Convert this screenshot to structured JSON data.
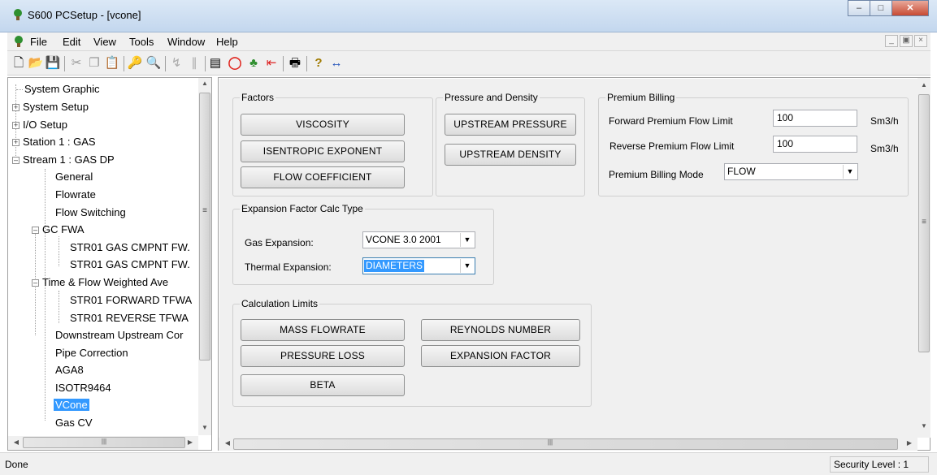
{
  "window": {
    "title": "S600 PCSetup - [vcone]"
  },
  "menu": {
    "file": "File",
    "edit": "Edit",
    "view": "View",
    "tools": "Tools",
    "window": "Window",
    "help": "Help"
  },
  "tree": {
    "items": [
      {
        "label": "System Graphic"
      },
      {
        "label": "System Setup"
      },
      {
        "label": "I/O Setup"
      },
      {
        "label": "Station 1 : GAS"
      },
      {
        "label": "Stream 1 : GAS DP"
      },
      {
        "label": "General"
      },
      {
        "label": "Flowrate"
      },
      {
        "label": "Flow Switching"
      },
      {
        "label": "GC FWA"
      },
      {
        "label": "STR01 GAS CMPNT FW."
      },
      {
        "label": "STR01 GAS CMPNT FW."
      },
      {
        "label": "Time & Flow Weighted Ave"
      },
      {
        "label": "STR01 FORWARD TFWA"
      },
      {
        "label": "STR01 REVERSE TFWA"
      },
      {
        "label": "Downstream Upstream Cor"
      },
      {
        "label": "Pipe Correction"
      },
      {
        "label": "AGA8"
      },
      {
        "label": "ISOTR9464"
      },
      {
        "label": "VCone"
      },
      {
        "label": "Gas CV"
      }
    ]
  },
  "factors": {
    "legend": "Factors",
    "viscosity": "VISCOSITY",
    "isentropic": "ISENTROPIC EXPONENT",
    "flow_coeff": "FLOW COEFFICIENT"
  },
  "pressure": {
    "legend": "Pressure and Density",
    "upstream_pressure": "UPSTREAM PRESSURE",
    "upstream_density": "UPSTREAM DENSITY"
  },
  "premium": {
    "legend": "Premium Billing",
    "forward_label": "Forward Premium Flow Limit",
    "forward_value": "100",
    "forward_unit": "Sm3/h",
    "reverse_label": "Reverse Premium Flow Limit",
    "reverse_value": "100",
    "reverse_unit": "Sm3/h",
    "mode_label": "Premium Billing Mode",
    "mode_value": "FLOW"
  },
  "expansion": {
    "legend": "Expansion Factor Calc Type",
    "gas_label": "Gas Expansion:",
    "gas_value": "VCONE 3.0 2001",
    "thermal_label": "Thermal Expansion:",
    "thermal_value": "DIAMETERS"
  },
  "limits": {
    "legend": "Calculation Limits",
    "mass_flowrate": "MASS FLOWRATE",
    "reynolds": "REYNOLDS NUMBER",
    "pressure_loss": "PRESSURE LOSS",
    "expansion_factor": "EXPANSION FACTOR",
    "beta": "BETA"
  },
  "status": {
    "text": "Done",
    "security": "Security Level : 1"
  }
}
